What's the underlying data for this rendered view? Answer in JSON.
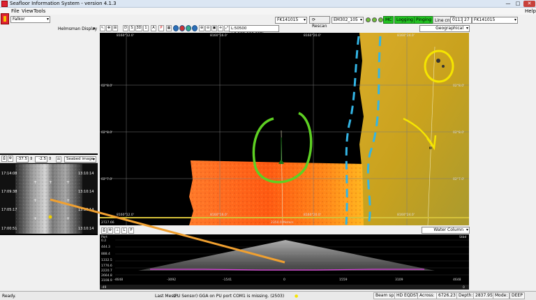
{
  "window": {
    "title": "Seafloor Information System - version 4.1.3",
    "min": "—",
    "max": "□",
    "close": "✕"
  },
  "menu": {
    "file": "File",
    "view": "View",
    "tools": "Tools",
    "help": "Help"
  },
  "ship": {
    "name": "Falkor"
  },
  "helmsman": {
    "label": "Helmsman Display"
  },
  "toolbar": {
    "buttons": [
      "D",
      "S",
      "3D",
      "1",
      "A",
      "P"
    ],
    "coord_readout": "L:50500 (-2.10N,160.26E)",
    "projection": "Geographical"
  },
  "acquisition": {
    "cruise": "FK141015",
    "rescan": "Rescan",
    "sounder": "EM302_105",
    "leds": [
      "#6fbf3a",
      "#6fbf3a",
      "#6fbf3a",
      "#6fbf3a"
    ],
    "mc": "MC",
    "logging": "Logging",
    "pinging": "Pinging",
    "line_cnt_label": "Line cnt:",
    "line_cnt": "0113",
    "line_num": "27",
    "line_name": "FK141015"
  },
  "map": {
    "top_labels": [
      "8160°12.0'",
      "8160°16.0'",
      "8160°20.0'",
      "8160°24.0'"
    ],
    "bottom_labels": [
      "8160°12.0'",
      "8160°16.0'",
      "8160°20.0'",
      "8160°24.0'"
    ],
    "left_labels": [
      "02°8.0'",
      "02°8.0'",
      "02°7.0'"
    ],
    "right_labels": [
      "02°8.0'",
      "02°8.0'",
      "02°7.0'"
    ],
    "corner_bl": "2727.66",
    "bottom_center": "2350.0 Meters",
    "colors": {
      "orange": "#ff5a12",
      "yellow": "#c9a21e"
    }
  },
  "side": {
    "val1": "-37.5",
    "val2": "-2.5",
    "image_mode": "Seabed image",
    "left_times": [
      "17:14:08",
      "17:09:38",
      "17:05:17",
      "17:00:51"
    ],
    "right_times": [
      "13:10:14",
      "13:10:14",
      "13:10:14",
      "13:10:14"
    ]
  },
  "water_column": {
    "label": "Water Column",
    "left_top": "Port",
    "right_top": "Stbd",
    "depth_ticks": [
      "0.2",
      "444.3",
      "888.4",
      "1332.5",
      "1776.6",
      "2220.7",
      "2664.8",
      "3108.9"
    ],
    "x_ticks": [
      "-4648",
      "-3092",
      "-1541",
      "0",
      "1559",
      "3109",
      "4648"
    ],
    "lower_left": "-49",
    "lower_right": "0"
  },
  "status": {
    "ready": "Ready.",
    "last_msg_label": "Last Mess.:",
    "last_msg": "(PU Sensor) GGA on PU port COM1 is missing. (2503)",
    "beam_sp_label": "Beam sp.:",
    "beam_sp": "HD EQDST",
    "across_label": "Across:",
    "across": "6726.23",
    "depth_label": "Depth:",
    "depth": "2837.95",
    "mode_label": "Mode:",
    "mode": "DEEP"
  }
}
